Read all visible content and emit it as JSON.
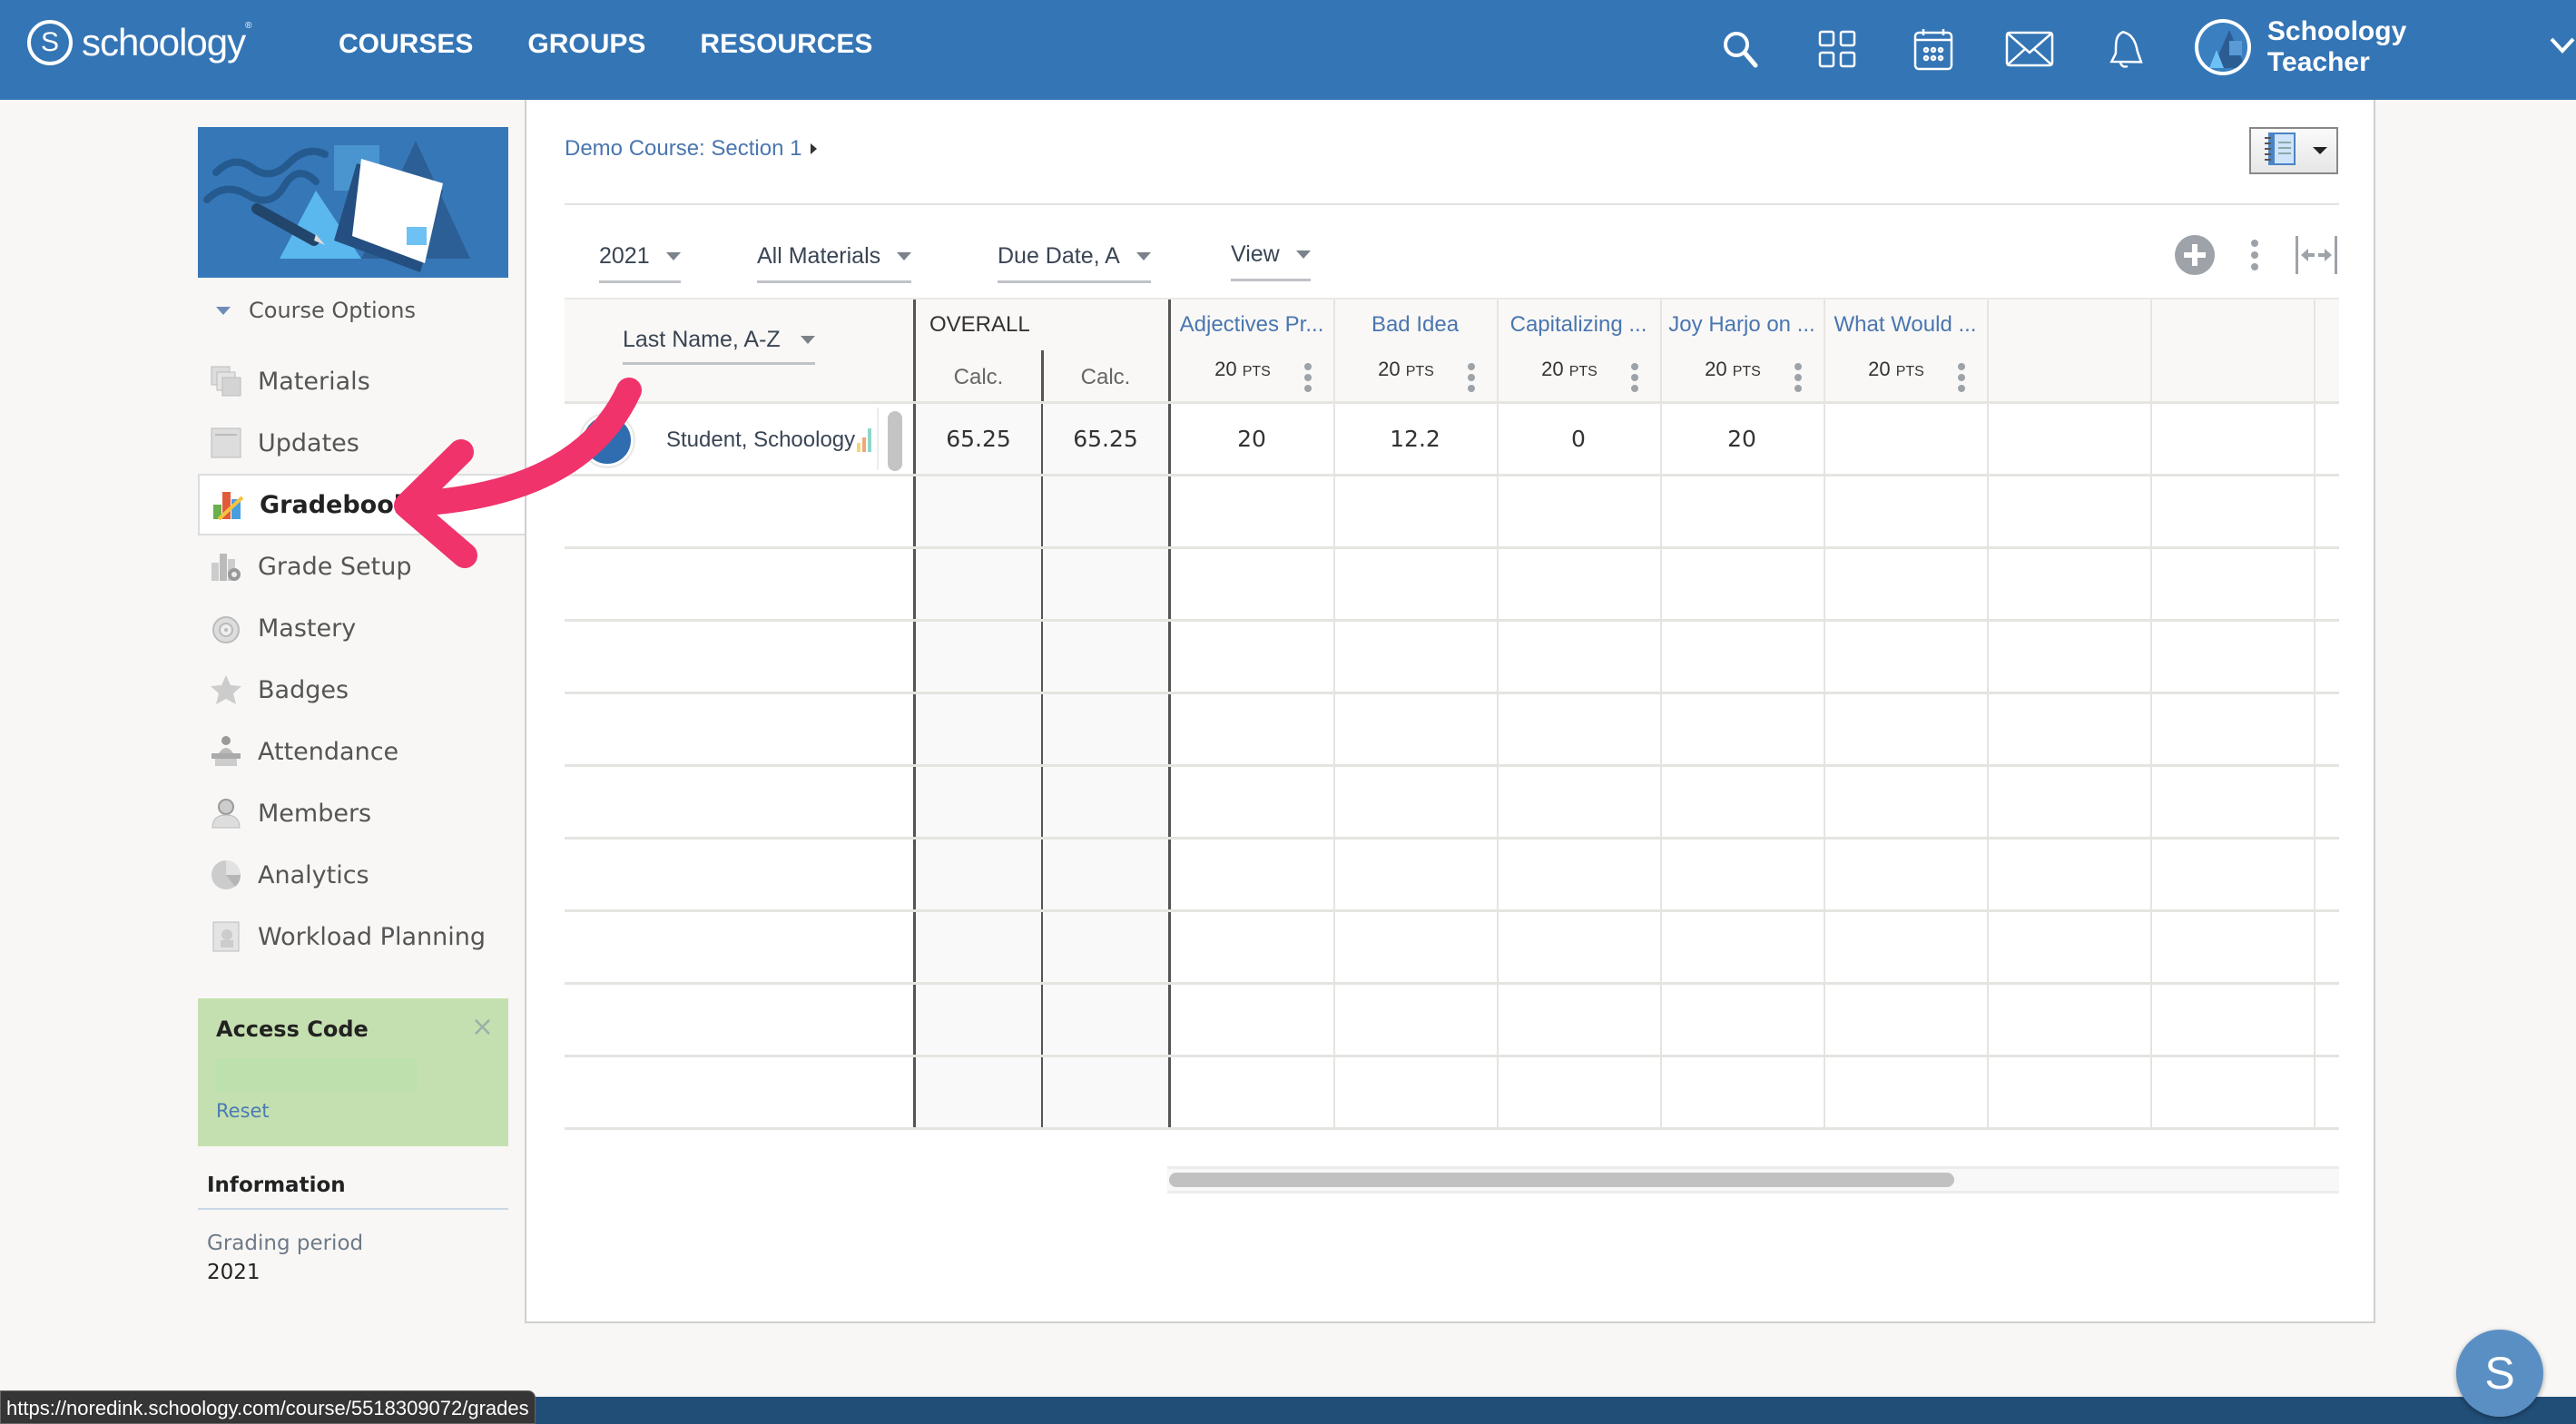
{
  "topnav": {
    "logo_text": "schoology",
    "logo_mark": "S",
    "links": [
      "COURSES",
      "GROUPS",
      "RESOURCES"
    ],
    "icons": [
      "search-icon",
      "apps-grid-icon",
      "calendar-icon",
      "mail-icon",
      "bell-icon"
    ],
    "user_name": "Schoology Teacher",
    "brand_color": "#3475b5"
  },
  "sidebar": {
    "course_options_label": "Course Options",
    "items": [
      {
        "label": "Materials",
        "icon": "materials-icon"
      },
      {
        "label": "Updates",
        "icon": "updates-icon"
      },
      {
        "label": "Gradebook",
        "icon": "gradebook-icon",
        "active": true
      },
      {
        "label": "Grade Setup",
        "icon": "grade-setup-icon"
      },
      {
        "label": "Mastery",
        "icon": "mastery-icon"
      },
      {
        "label": "Badges",
        "icon": "badge-star-icon"
      },
      {
        "label": "Attendance",
        "icon": "attendance-icon"
      },
      {
        "label": "Members",
        "icon": "members-icon"
      },
      {
        "label": "Analytics",
        "icon": "analytics-pie-icon"
      },
      {
        "label": "Workload Planning",
        "icon": "workload-planning-icon"
      }
    ],
    "access_code": {
      "title": "Access Code",
      "value": "",
      "reset_label": "Reset",
      "close_glyph": "×"
    },
    "information": {
      "title": "Information",
      "grading_period_label": "Grading period",
      "grading_period_value": "2021"
    }
  },
  "main": {
    "breadcrumb": "Demo Course: Section 1",
    "filters": {
      "period": "2021",
      "materials": "All Materials",
      "sort": "Due Date, A",
      "view": "View"
    },
    "gradebook": {
      "student_sort": "Last Name, A-Z",
      "overall_label": "OVERALL",
      "overall_cols": [
        "Calc.",
        "Calc."
      ],
      "assignments": [
        {
          "title": "Adjectives Pr...",
          "points": "20",
          "pts_unit": "PTS"
        },
        {
          "title": "Bad Idea",
          "points": "20",
          "pts_unit": "PTS"
        },
        {
          "title": "Capitalizing ...",
          "points": "20",
          "pts_unit": "PTS"
        },
        {
          "title": "Joy Harjo on ...",
          "points": "20",
          "pts_unit": "PTS"
        },
        {
          "title": "What Would ...",
          "points": "20",
          "pts_unit": "PTS"
        }
      ],
      "students": [
        {
          "name": "Student, Schoology",
          "overall": [
            "65.25",
            "65.25"
          ],
          "grades": [
            "20",
            "12.2",
            "0",
            "20",
            ""
          ]
        }
      ],
      "empty_rows": 9,
      "horizontal_scroll_fraction": 0.67
    }
  },
  "status_url": "https://noredink.schoology.com/course/5518309072/grades",
  "help_fab_label": "S",
  "annotation": {
    "color": "#f0336b",
    "points_to": "Gradebook"
  }
}
